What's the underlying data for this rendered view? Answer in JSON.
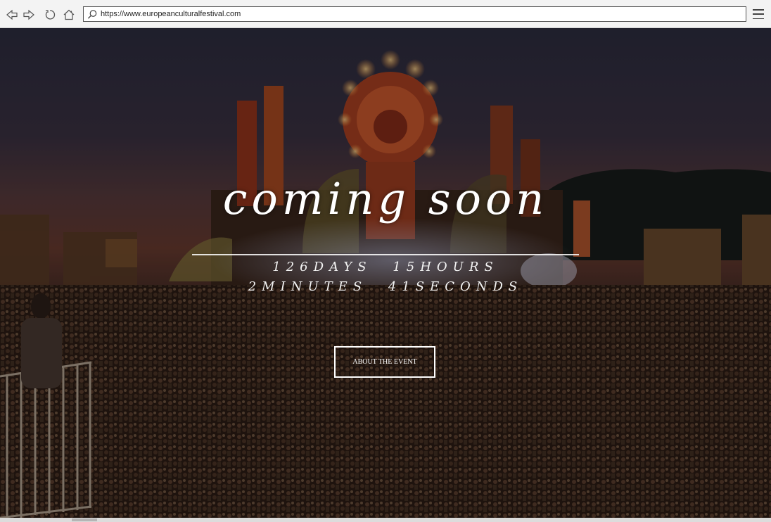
{
  "browser": {
    "url": "https://www.europeanculturalfestival.com",
    "icons": [
      "back-icon",
      "forward-icon",
      "reload-icon",
      "home-icon",
      "search-icon",
      "menu-icon"
    ]
  },
  "hero": {
    "title": "coming soon",
    "countdown": {
      "days": "126DAYS",
      "hours": "15HOURS",
      "minutes": "2MINUTES",
      "seconds": "41SECONDS"
    },
    "cta_label": "ABOUT THE EVENT"
  },
  "colors": {
    "text": "#ffffff",
    "sky_top": "#2b2b3e",
    "sunset": "#6a3a2c",
    "stage_glow": "#e0542a"
  }
}
